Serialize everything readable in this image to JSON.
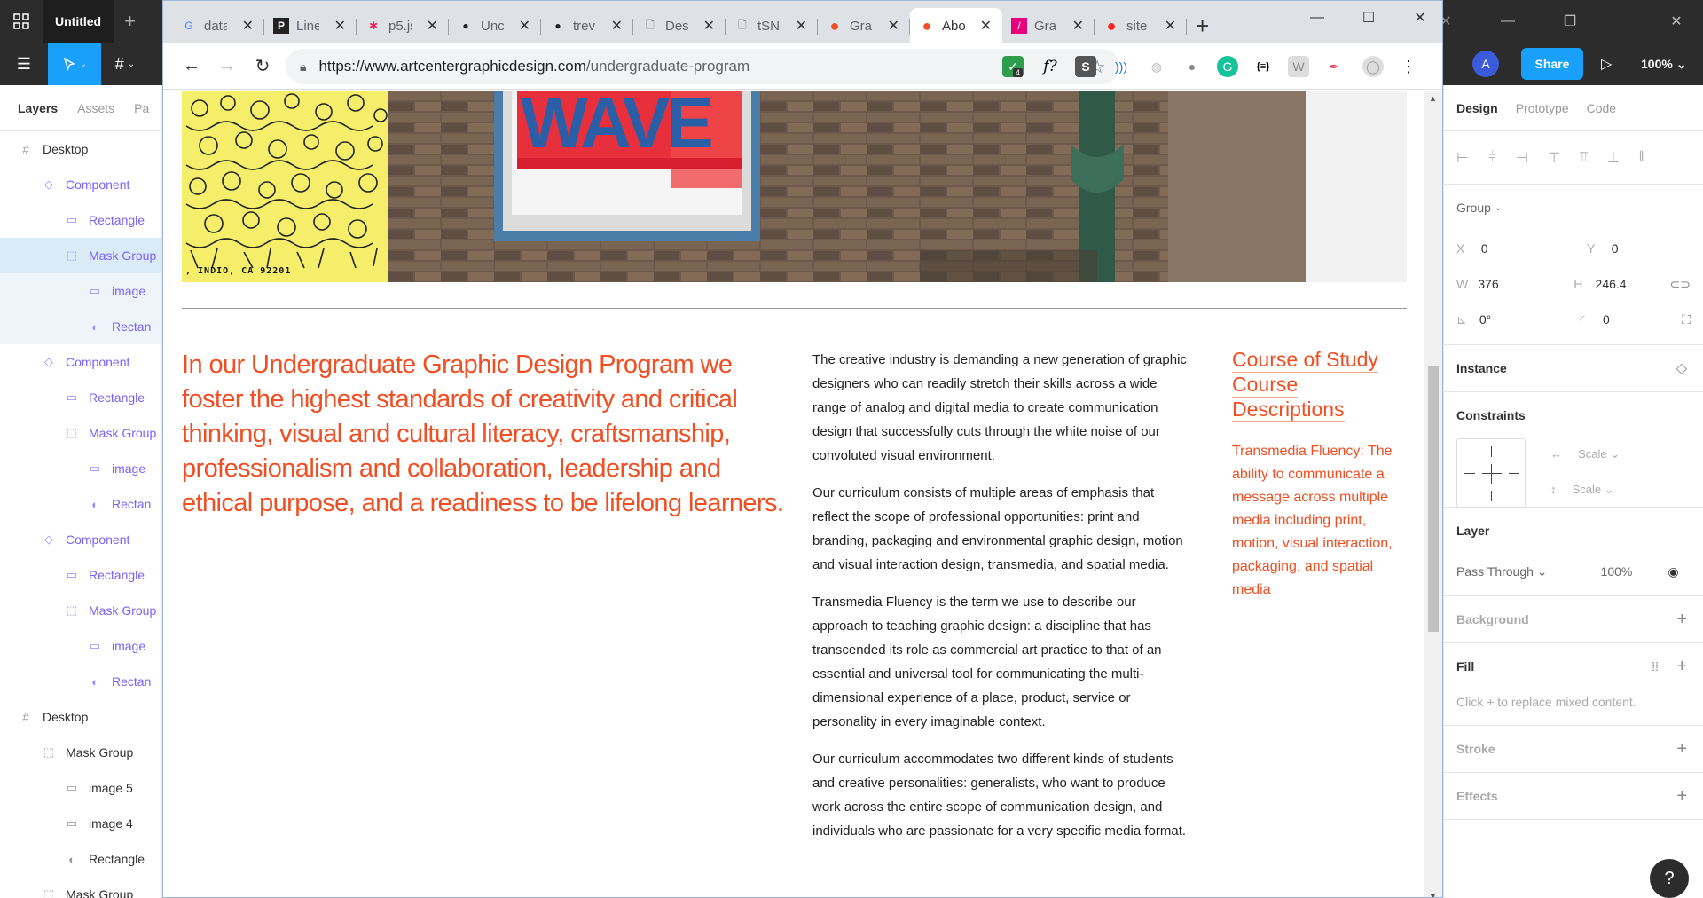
{
  "figma": {
    "file_tab": "Untitled",
    "zoom": "100%",
    "share_label": "Share",
    "avatar_initial": "A",
    "left_panel": {
      "tabs": [
        "Layers",
        "Assets",
        "Pa"
      ],
      "layers": [
        {
          "label": "Desktop",
          "icon": "frame-icon",
          "depth": 0,
          "style": "normal"
        },
        {
          "label": "Component",
          "icon": "component-icon",
          "depth": 1,
          "style": "purple"
        },
        {
          "label": "Rectangle",
          "icon": "rectangle-icon",
          "depth": 2,
          "style": "purple"
        },
        {
          "label": "Mask Group",
          "icon": "mask-group-icon",
          "depth": 2,
          "style": "purple-selected"
        },
        {
          "label": "image",
          "icon": "image-icon",
          "depth": 3,
          "style": "purple-sub"
        },
        {
          "label": "Rectan",
          "icon": "mask-icon",
          "depth": 3,
          "style": "purple-sub"
        },
        {
          "label": "Component",
          "icon": "component-icon",
          "depth": 1,
          "style": "purple"
        },
        {
          "label": "Rectangle",
          "icon": "rectangle-icon",
          "depth": 2,
          "style": "purple"
        },
        {
          "label": "Mask Group",
          "icon": "mask-group-icon",
          "depth": 2,
          "style": "purple"
        },
        {
          "label": "image",
          "icon": "image-icon",
          "depth": 3,
          "style": "purple"
        },
        {
          "label": "Rectan",
          "icon": "mask-icon",
          "depth": 3,
          "style": "purple"
        },
        {
          "label": "Component",
          "icon": "component-icon",
          "depth": 1,
          "style": "purple"
        },
        {
          "label": "Rectangle",
          "icon": "rectangle-icon",
          "depth": 2,
          "style": "purple"
        },
        {
          "label": "Mask Group",
          "icon": "mask-group-icon",
          "depth": 2,
          "style": "purple"
        },
        {
          "label": "image",
          "icon": "image-icon",
          "depth": 3,
          "style": "purple"
        },
        {
          "label": "Rectan",
          "icon": "mask-icon",
          "depth": 3,
          "style": "purple"
        },
        {
          "label": "Desktop",
          "icon": "frame-icon",
          "depth": 0,
          "style": "normal"
        },
        {
          "label": "Mask Group",
          "icon": "mask-group-icon",
          "depth": 1,
          "style": "normal"
        },
        {
          "label": "image 5",
          "icon": "image-icon",
          "depth": 2,
          "style": "normal"
        },
        {
          "label": "image 4",
          "icon": "image-icon",
          "depth": 2,
          "style": "normal"
        },
        {
          "label": "Rectangle",
          "icon": "mask-icon",
          "depth": 2,
          "style": "normal"
        },
        {
          "label": "Mask Group",
          "icon": "mask-group-icon",
          "depth": 1,
          "style": "normal"
        }
      ]
    },
    "right_panel": {
      "tabs": [
        "Design",
        "Prototype",
        "Code"
      ],
      "group_label": "Group",
      "x_label": "X",
      "x_value": "0",
      "y_label": "Y",
      "y_value": "0",
      "w_label": "W",
      "w_value": "376",
      "h_label": "H",
      "h_value": "246.4",
      "rotation": "0°",
      "radius": "0",
      "instance_title": "Instance",
      "constraints_title": "Constraints",
      "constraint_h": "Scale",
      "constraint_v": "Scale",
      "layer_title": "Layer",
      "blend_mode": "Pass Through",
      "opacity": "100%",
      "background_title": "Background",
      "fill_title": "Fill",
      "fill_hint": "Click + to replace mixed content.",
      "stroke_title": "Stroke",
      "effects_title": "Effects"
    }
  },
  "chrome": {
    "tabs": [
      {
        "title": "data",
        "icon": "google-icon",
        "color": "#4285f4"
      },
      {
        "title": "Line",
        "icon": "p-logo-icon",
        "color": "#222222"
      },
      {
        "title": "p5.js",
        "icon": "asterisk-icon",
        "color": "#ed225d"
      },
      {
        "title": "Unc",
        "icon": "github-icon",
        "color": "#222222"
      },
      {
        "title": "trev",
        "icon": "github-icon",
        "color": "#222222"
      },
      {
        "title": "Des",
        "icon": "document-icon",
        "color": "#5f6368"
      },
      {
        "title": "tSN",
        "icon": "document-icon",
        "color": "#5f6368"
      },
      {
        "title": "Gra",
        "icon": "orange-dot-icon",
        "color": "#f04e23"
      },
      {
        "title": "Abo",
        "icon": "artcenter-icon",
        "color": "#f04e23",
        "active": true
      },
      {
        "title": "Gra",
        "icon": "slash-icon",
        "color": "#e6007e"
      },
      {
        "title": "site",
        "icon": "red-dot-icon",
        "color": "#f42222"
      }
    ],
    "url_host": "https://www.artcentergraphicdesign.com",
    "url_path": "/undergraduate-program",
    "extension_badge": "4"
  },
  "page": {
    "hero_caption": ", INDIO, CA 92201",
    "hero_sign_text": "WAVE",
    "intro_text": "In our Undergraduate Graphic Design Program we foster the highest standards of creativity and critical thinking, visual and cultural literacy, craftsmanship, professionalism and collaboration, leadership and ethical purpose, and a readiness to be lifelong learners.",
    "body_paragraphs": [
      "The creative industry is demanding a new generation of graphic designers who can readily stretch their skills across a wide range of analog and digital media to create communication design that successfully cuts through the white noise of our convoluted visual environment.",
      "Our curriculum consists of multiple areas of emphasis that reflect the scope of professional opportunities: print and branding, packaging and environmental graphic design, motion and visual interaction design, transmedia, and spatial media.",
      "Transmedia Fluency is the term we use to describe our approach to teaching graphic design: a discipline that has transcended its role as commercial art practice to that of an essential and universal tool for communicating the multi-dimensional experience of a place, product, service or personality in every imaginable context.",
      "Our curriculum accommodates two different kinds of students and creative personalities: generalists, who want to produce work across the entire scope of communication design, and individuals who are passionate for a very specific media format."
    ],
    "side_links": [
      "Course of Study",
      "Course",
      "Descriptions"
    ],
    "side_description": "Transmedia Fluency: The ability to communicate a message across multiple media including print, motion, visual interaction, packaging, and spatial media",
    "accent_color": "#f04e23"
  }
}
